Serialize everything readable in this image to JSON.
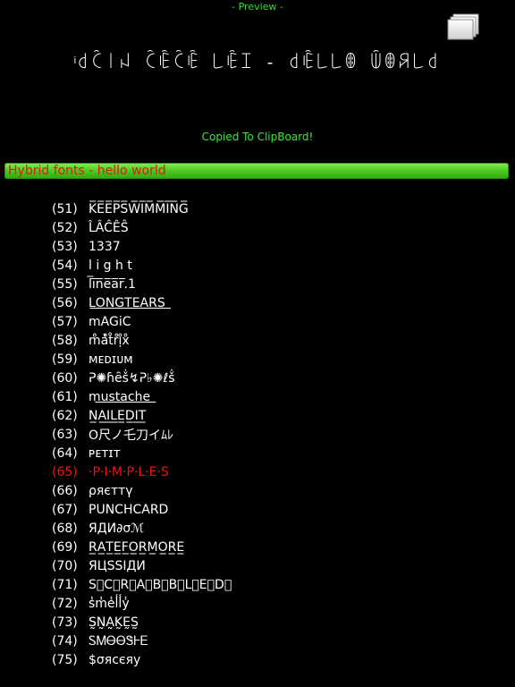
{
  "header": {
    "preview_label": "- Preview -",
    "preview_text": "ͥ꒯ꉓ꒐ꈤ ꉓꍟꉓꍟ ꒒ꍟꀤ - ꒯ꍟ꒒꒒ꂦ ꅏꂦꋪ꒒꒯",
    "copy_icon": "copy-icon"
  },
  "status": {
    "message": "Copied To ClipBoard!"
  },
  "section": {
    "title": "Hybrid fonts - hello world"
  },
  "fonts": [
    {
      "num": "(51)",
      "sample": "K̅E̅E̅P̅S̅W̅I̅M̅M̅I̅N̅G̅",
      "selected": false
    },
    {
      "num": "(52)",
      "sample": "L̂ÂĈÊŜ",
      "selected": false
    },
    {
      "num": "(53)",
      "sample": "1337",
      "selected": false
    },
    {
      "num": "(54)",
      "sample": "l i g h t",
      "selected": false
    },
    {
      "num": "(55)",
      "sample": "l̅i̅n̅e̅a̅r̅.1",
      "selected": false
    },
    {
      "num": "(56)",
      "sample": "L͟O͟N͟G͟T͟E͟A͟R͟S͟",
      "selected": false
    },
    {
      "num": "(57)",
      "sample": "mAGiC",
      "selected": false
    },
    {
      "num": "(58)",
      "sample": "m̊ả̊t̊r̊ị̊x̊",
      "selected": false
    },
    {
      "num": "(59)",
      "sample": "ᴍᴇᴅɪᴜᴍ",
      "selected": false
    },
    {
      "num": "(60)",
      "sample": "ᕈ✺ɦȇṧ↯ᕈ♭✺ℓṧ",
      "selected": false
    },
    {
      "num": "(61)",
      "sample": "m͟u͟s͟t͟a͟c͟h͟e͟",
      "selected": false
    },
    {
      "num": "(62)",
      "sample": "N̲A̲I̲L̲E̲D̲I̲T̲",
      "selected": false
    },
    {
      "num": "(63)",
      "sample": " O尺ノ乇刀イﾑﾚ",
      "selected": false
    },
    {
      "num": "(64)",
      "sample": "ᴘᴇᴛɪᴛ",
      "selected": false
    },
    {
      "num": "(65)",
      "sample": "·P·I·M·P·L·E·S",
      "selected": true
    },
    {
      "num": "(66)",
      "sample": "ρяєттү",
      "selected": false
    },
    {
      "num": "(67)",
      "sample": "PUNCHCARD",
      "selected": false
    },
    {
      "num": "(68)",
      "sample": "ЯДИ∂σℳ",
      "selected": false
    },
    {
      "num": "(69)",
      "sample": "R̲A̲T̲E̲F̲O̲R̲M̲O̲R̲E̲",
      "selected": false
    },
    {
      "num": "(70)",
      "sample": "ЯЦSSIДИ",
      "selected": false
    },
    {
      "num": "(71)",
      "sample": "S⃞C⃞R⃞A⃞B⃞B⃞L⃞E⃞D⃞",
      "selected": false
    },
    {
      "num": "(72)",
      "sample": "s̾m̾e̾l̾l̾y̾",
      "selected": false
    },
    {
      "num": "(73)",
      "sample": "S̰N̰A̰K̰ḚS̰",
      "selected": false
    },
    {
      "num": "(74)",
      "sample": "ᏚᎷᎾᎾᏕᎰᎬ",
      "selected": false
    },
    {
      "num": "(75)",
      "sample": "$σяcєяy",
      "selected": false
    }
  ],
  "colors": {
    "background": "#000000",
    "status_green": "#33ee33",
    "header_gradient_top": "#8ef05a",
    "header_gradient_bottom": "#2fa811",
    "header_text_red": "#e11a10",
    "selected_red": "#ee1111"
  }
}
